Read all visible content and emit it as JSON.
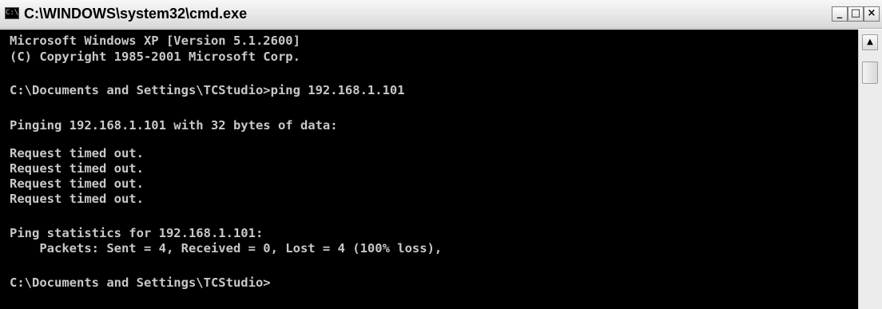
{
  "window": {
    "title": "C:\\WINDOWS\\system32\\cmd.exe",
    "icon_glyph": "C:\\",
    "controls": {
      "minimize": "_",
      "maximize": "□",
      "close": "×"
    }
  },
  "console": {
    "lines": [
      "Microsoft Windows XP [Version 5.1.2600]",
      "(C) Copyright 1985-2001 Microsoft Corp.",
      "",
      "C:\\Documents and Settings\\TCStudio>ping 192.168.1.101",
      "",
      "Pinging 192.168.1.101 with 32 bytes of data:",
      "",
      "Request timed out.",
      "Request timed out.",
      "Request timed out.",
      "Request timed out.",
      "",
      "Ping statistics for 192.168.1.101:",
      "    Packets: Sent = 4, Received = 0, Lost = 4 (100% loss),",
      "",
      "C:\\Documents and Settings\\TCStudio>"
    ]
  },
  "scrollbar": {
    "up_arrow": "▲"
  }
}
